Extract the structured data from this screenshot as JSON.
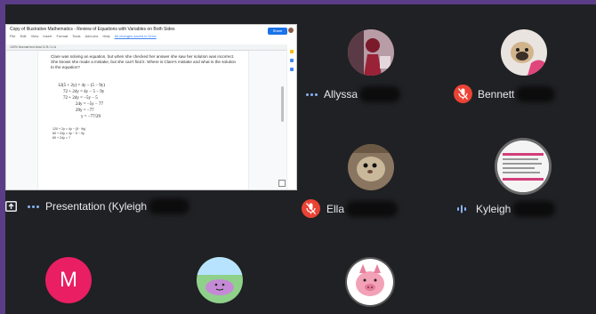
{
  "presentation": {
    "doc_title": "Copy of Illustrative Mathematics - Review of Equations with Variables on Both Sides",
    "menu": [
      "File",
      "Edit",
      "View",
      "Insert",
      "Format",
      "Tools",
      "Add-ons",
      "Help"
    ],
    "last_edit": "All changes saved in Drive",
    "share_label": "Share",
    "toolbar_text": "100%   Normal text   Arial   11   B  I  U  A",
    "prompt": "Clare was solving an equation, but when she checked her answer she saw her solution was incorrect. She knows she made a mistake, but she can't find it. Where is Clare's mistake and what is the solution to the equation?",
    "equations": [
      "12(5 + 2y) = 4y − (5 − 9y)",
      "72 + 24y = 4y − 5 − 9y",
      "72 + 24y = −5y − 5",
      "24y = −5y − 77",
      "29y = −77",
      "y = −77/29"
    ],
    "notes": [
      "120 + 2y = 4y − (5 · 9y)",
      "60 + 24y = 4y − 5 − 9y",
      "60 + 24y = ?"
    ],
    "owner_label": "Presentation (Kyleigh"
  },
  "participants": [
    {
      "name": "Allyssa",
      "status": "speaking-dots"
    },
    {
      "name": "Bennett",
      "status": "muted"
    },
    {
      "name": "Ella",
      "status": "muted"
    },
    {
      "name": "Kyleigh",
      "status": "audio-bars"
    },
    {
      "name": "",
      "initial": "M",
      "avatar_color": "#e91e63"
    }
  ],
  "colors": {
    "background": "#202124",
    "frame": "#5a3d86",
    "muted": "#ea4335",
    "accent": "#8ab4f8",
    "m_avatar": "#e91e63"
  },
  "icons": [
    "present-screen-icon",
    "more-dots-icon",
    "mic-off-icon",
    "audio-level-icon"
  ]
}
